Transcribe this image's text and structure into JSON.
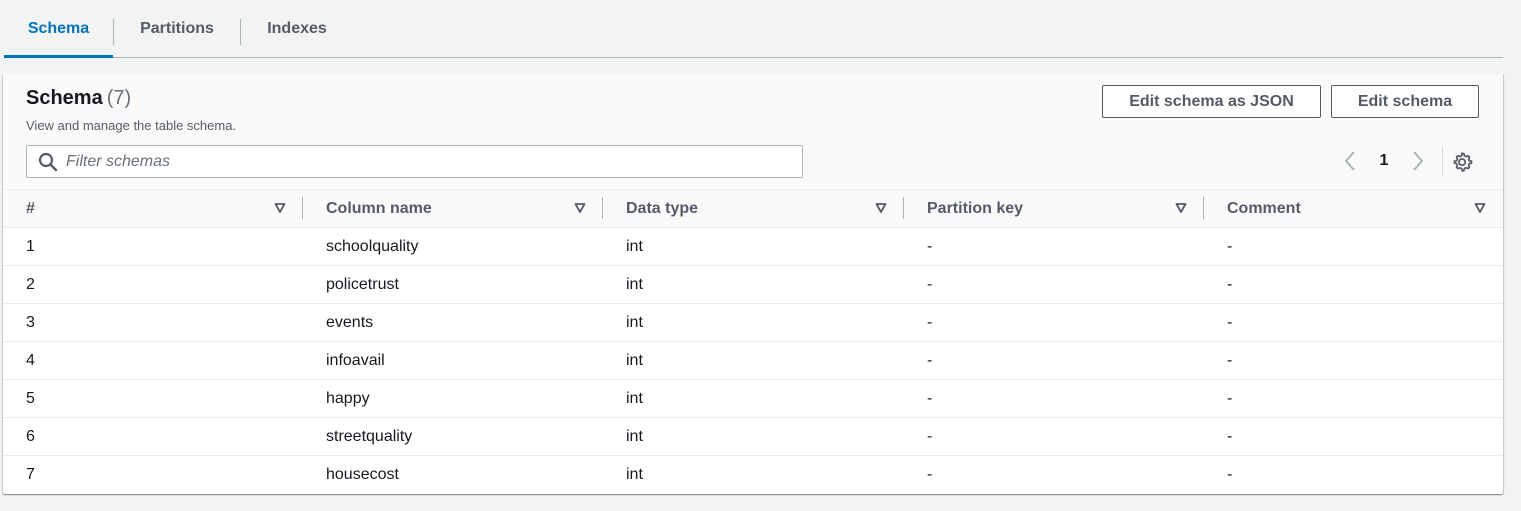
{
  "tabs": [
    {
      "label": "Schema",
      "active": true
    },
    {
      "label": "Partitions",
      "active": false
    },
    {
      "label": "Indexes",
      "active": false
    }
  ],
  "panel": {
    "title": "Schema",
    "count": "(7)",
    "description": "View and manage the table schema.",
    "edit_json_label": "Edit schema as JSON",
    "edit_label": "Edit schema",
    "filter_placeholder": "Filter schemas"
  },
  "pagination": {
    "current_page": "1"
  },
  "icons": {
    "search": "search-icon",
    "prev": "chevron-left-icon",
    "next": "chevron-right-icon",
    "settings": "gear-icon",
    "sort": "caret-down-icon"
  },
  "colors": {
    "accent": "#0073bb",
    "text": "#16191f",
    "muted": "#545b64"
  },
  "table": {
    "columns": [
      "#",
      "Column name",
      "Data type",
      "Partition key",
      "Comment"
    ],
    "rows": [
      [
        "1",
        "schoolquality",
        "int",
        "-",
        "-"
      ],
      [
        "2",
        "policetrust",
        "int",
        "-",
        "-"
      ],
      [
        "3",
        "events",
        "int",
        "-",
        "-"
      ],
      [
        "4",
        "infoavail",
        "int",
        "-",
        "-"
      ],
      [
        "5",
        "happy",
        "int",
        "-",
        "-"
      ],
      [
        "6",
        "streetquality",
        "int",
        "-",
        "-"
      ],
      [
        "7",
        "housecost",
        "int",
        "-",
        "-"
      ]
    ]
  }
}
